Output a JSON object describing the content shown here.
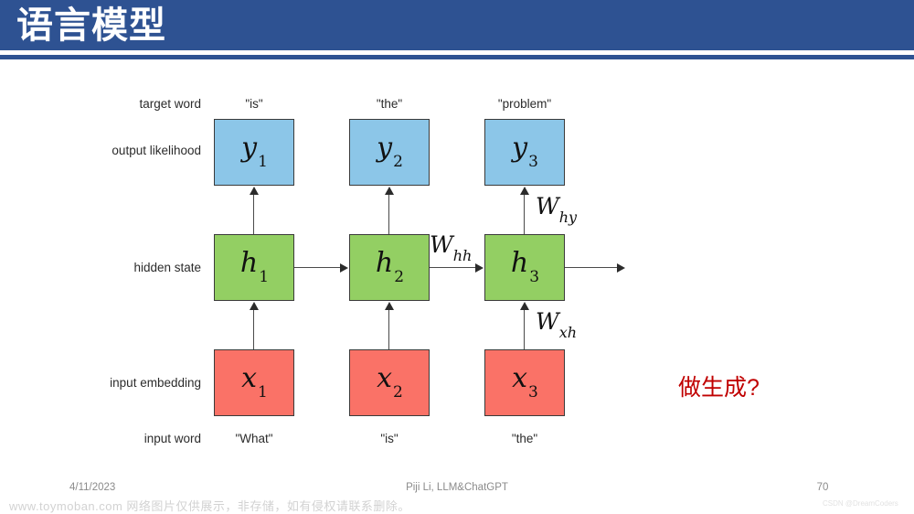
{
  "slide": {
    "title": "语言模型",
    "banner_color": "#2e5292",
    "annotation": "做生成?",
    "annotation_color": "#c00000"
  },
  "diagram": {
    "row_labels": [
      {
        "key": "target_word",
        "text": "target word"
      },
      {
        "key": "output_likelihood",
        "text": "output likelihood"
      },
      {
        "key": "hidden_state",
        "text": "hidden state"
      },
      {
        "key": "input_embedding",
        "text": "input embedding"
      },
      {
        "key": "input_word",
        "text": "input word"
      }
    ],
    "target_words": [
      "\"is\"",
      "\"the\"",
      "\"problem\""
    ],
    "input_words": [
      "\"What\"",
      "\"is\"",
      "\"the\""
    ],
    "output_nodes": [
      {
        "base": "y",
        "sub": "1"
      },
      {
        "base": "y",
        "sub": "2"
      },
      {
        "base": "y",
        "sub": "3"
      }
    ],
    "hidden_nodes": [
      {
        "base": "h",
        "sub": "1"
      },
      {
        "base": "h",
        "sub": "2"
      },
      {
        "base": "h",
        "sub": "3"
      }
    ],
    "input_nodes": [
      {
        "base": "x",
        "sub": "1"
      },
      {
        "base": "x",
        "sub": "2"
      },
      {
        "base": "x",
        "sub": "3"
      }
    ],
    "weights": [
      {
        "key": "w_hy",
        "base": "W",
        "sub": "hy"
      },
      {
        "key": "w_hh",
        "base": "W",
        "sub": "hh"
      },
      {
        "key": "w_xh",
        "base": "W",
        "sub": "xh"
      }
    ],
    "colors": {
      "output": "#8cc6e8",
      "hidden": "#93cf63",
      "input": "#fa7267",
      "stroke": "#3a3a3a"
    }
  },
  "footer": {
    "date": "4/11/2023",
    "center": "Piji Li, LLM&ChatGPT",
    "page": "70"
  },
  "watermarks": {
    "bottom": "www.toymoban.com 网络图片仅供展示，非存储，如有侵权请联系删除。",
    "corner": "CSDN @DreamCoders"
  }
}
